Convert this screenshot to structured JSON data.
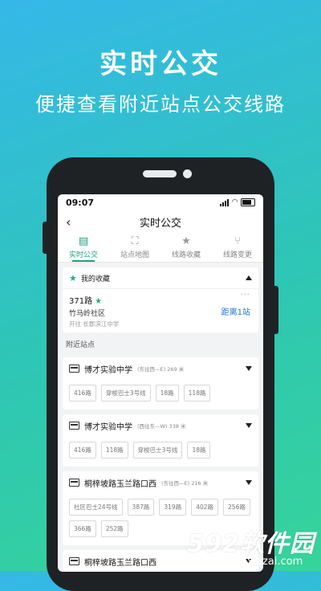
{
  "hero": {
    "title": "实时公交",
    "subtitle": "便捷查看附近站点公交线路"
  },
  "statusbar": {
    "time": "09:07"
  },
  "navbar": {
    "back": "‹",
    "title": "实时公交"
  },
  "tabs": [
    {
      "label": "实时公交",
      "icon": "bus-icon",
      "glyph": "▤",
      "active": true
    },
    {
      "label": "站点地图",
      "icon": "map-pin-icon",
      "glyph": "⛶",
      "active": false
    },
    {
      "label": "线路收藏",
      "icon": "star-icon",
      "glyph": "★",
      "active": false
    },
    {
      "label": "线路变更",
      "icon": "route-change-icon",
      "glyph": "⑂",
      "active": false
    }
  ],
  "favorites": {
    "header": "我的收藏",
    "route": "371路",
    "stop": "竹马岭社区",
    "direction": "开往 长郡滨江中学",
    "distance": "距离1站",
    "more": "···"
  },
  "nearby_label": "附近站点",
  "stations": [
    {
      "name": "博才实验中学",
      "meta": "(东往西—E) 269 米",
      "routes": [
        "416路",
        "穿梭巴士3号线",
        "18路",
        "118路"
      ]
    },
    {
      "name": "博才实验中学",
      "meta": "(西往东—W) 338 米",
      "routes": [
        "416路",
        "118路",
        "穿梭巴士3号线",
        "18路"
      ]
    },
    {
      "name": "桐梓坡路玉兰路口西",
      "meta": "(东往西—E) 216 米",
      "routes": [
        "社区巴士24号线",
        "387路",
        "319路",
        "402路",
        "256路",
        "366路",
        "252路"
      ]
    },
    {
      "name": "桐梓坡路玉兰路口西",
      "meta": "",
      "routes": []
    }
  ],
  "watermark": {
    "brand": "592软件园",
    "url": "www.592xiazai.com"
  },
  "colors": {
    "accent": "#1fa37a",
    "link": "#1d73d2"
  }
}
